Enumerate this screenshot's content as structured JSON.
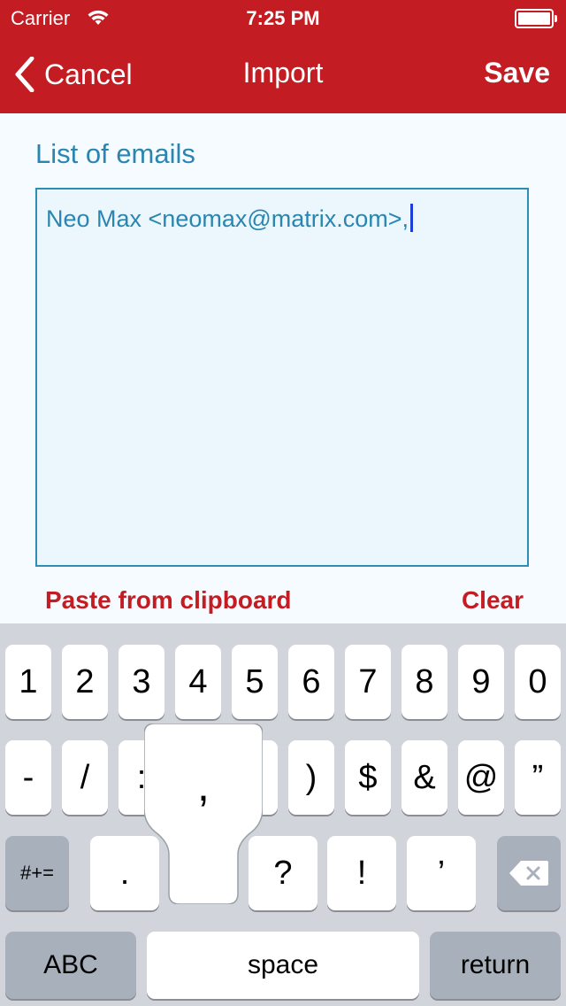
{
  "status": {
    "carrier": "Carrier",
    "time": "7:25 PM",
    "battery_level": 1.0
  },
  "nav": {
    "cancel_label": "Cancel",
    "title": "Import",
    "save_label": "Save"
  },
  "form": {
    "label": "List of emails",
    "value": "Neo Max <neomax@matrix.com>,",
    "paste_label": "Paste from clipboard",
    "clear_label": "Clear"
  },
  "keyboard": {
    "row1": [
      "1",
      "2",
      "3",
      "4",
      "5",
      "6",
      "7",
      "8",
      "9",
      "0"
    ],
    "row2": [
      "-",
      "/",
      ":",
      "(",
      ")",
      "$",
      "&",
      "@",
      "”"
    ],
    "row3_left": "#+=",
    "row3": [
      ".",
      ",",
      "?",
      "!",
      "’"
    ],
    "abc": "ABC",
    "space": "space",
    "return": "return",
    "popup_char": ",",
    "delete_icon": "backspace-icon"
  },
  "colors": {
    "brand": "#c31c22",
    "accent": "#2a86b0",
    "field_bg": "#ebf7fd"
  }
}
